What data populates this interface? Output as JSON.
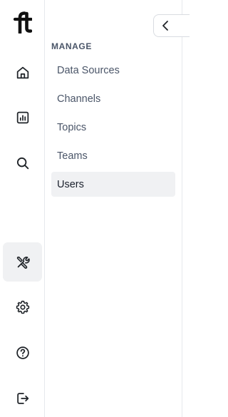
{
  "rail": {
    "logo": "ft",
    "icons": [
      {
        "name": "home-icon"
      },
      {
        "name": "chart-icon"
      },
      {
        "name": "search-icon"
      },
      {
        "name": "tools-icon",
        "active": true
      },
      {
        "name": "gear-icon"
      },
      {
        "name": "help-icon"
      },
      {
        "name": "logout-icon"
      }
    ]
  },
  "panel": {
    "section_label": "MANAGE",
    "items": [
      {
        "label": "Data Sources"
      },
      {
        "label": "Channels"
      },
      {
        "label": "Topics"
      },
      {
        "label": "Teams"
      },
      {
        "label": "Users",
        "active": true
      }
    ]
  },
  "collapse": {
    "icon": "chevron-left-icon"
  },
  "colors": {
    "active_bg": "#f0f1f3",
    "text_muted": "#4a5568",
    "text_active": "#1a202c",
    "icon": "#1f2328",
    "border": "#e6e8ec"
  }
}
